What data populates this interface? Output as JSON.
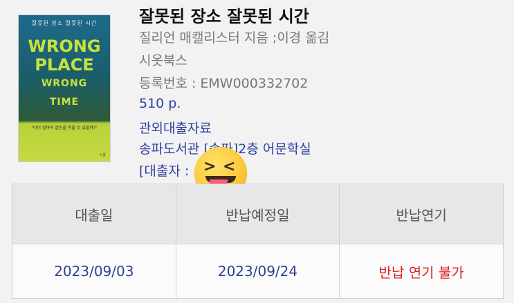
{
  "book": {
    "title": "잘못된 장소 잘못된 시간",
    "author": "질리언 매캘리스터 지음 ;이경 옮김",
    "publisher": "시옷북스",
    "registration": "등록번호 : EMW000332702",
    "pages": "510 p.",
    "loan_type": "관외대출자료",
    "location": "송파도서관 [송파]2층 어문학실",
    "borrower": "[대출자 :"
  },
  "cover": {
    "top_text": "잘못된 장소 잘못된 시간",
    "title_line1": "WRONG",
    "title_line2": "PLACE",
    "title_line3": "WRONG",
    "title_line4": "TIME",
    "quote": "\"아이 엄마의 살인을 막을 수 있을까?\"",
    "publisher_mark": "시옷"
  },
  "emoji": {
    "name": "face-with-tongue-squinting",
    "left_eye": ">",
    "right_eye": "<"
  },
  "loan_table": {
    "headers": [
      "대출일",
      "반납예정일",
      "반납연기"
    ],
    "row": [
      "2023/09/03",
      "2023/09/24",
      "반납 연기 불가"
    ],
    "colors": {
      "date": "#2d3f8f",
      "unavailable": "#e02020"
    }
  }
}
